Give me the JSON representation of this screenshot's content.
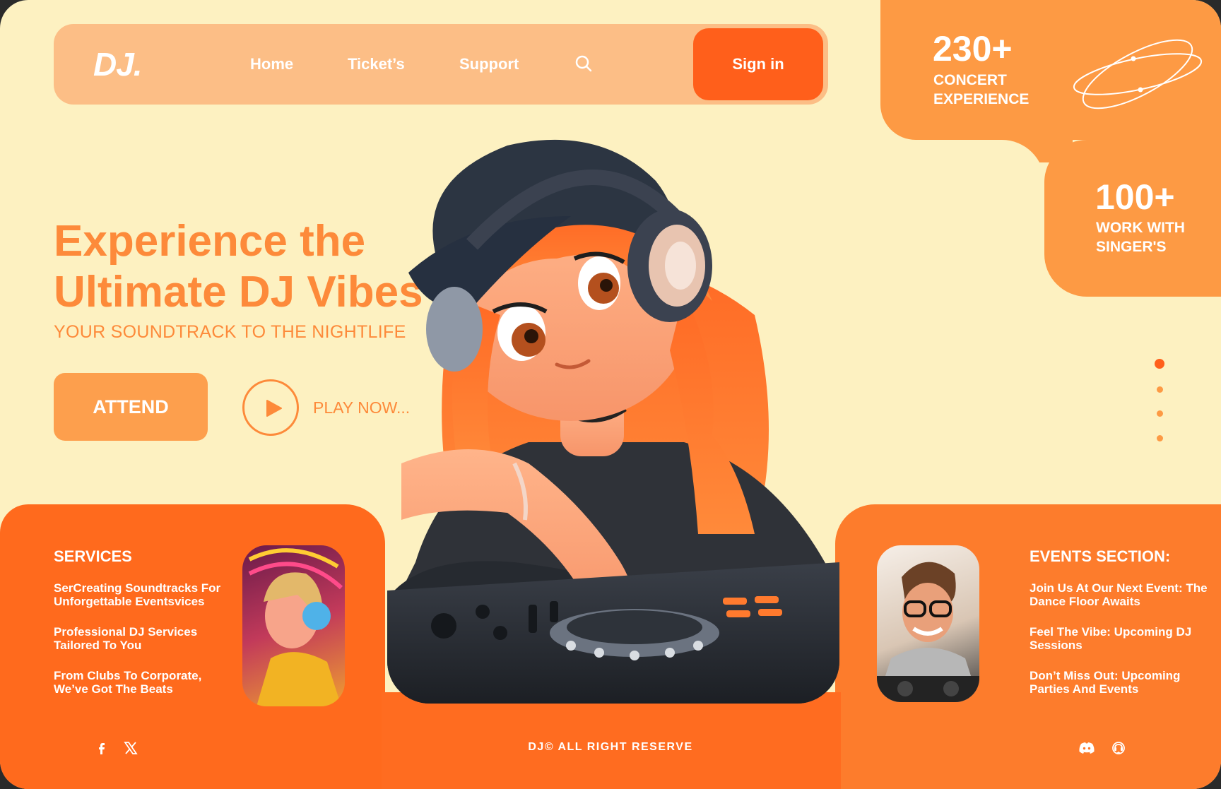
{
  "brand": {
    "logo": "DJ."
  },
  "nav": {
    "links": [
      "Home",
      "Ticket’s",
      "Support"
    ],
    "signin": "Sign in"
  },
  "stats": [
    {
      "value": "230+",
      "label_line1": "CONCERT",
      "label_line2": "EXPERIENCE"
    },
    {
      "value": "100+",
      "label_line1": "WORK WITH",
      "label_line2": "SINGER'S"
    }
  ],
  "hero": {
    "title_line1": "Experience the",
    "title_line2": "Ultimate DJ Vibes",
    "subtitle": "YOUR SOUNDTRACK TO THE NIGHTLIFE",
    "attend": "ATTEND",
    "play": "PLAY NOW..."
  },
  "slider": {
    "count": 4,
    "active_index": 0
  },
  "services": {
    "title": "SERVICES",
    "items": [
      {
        "l1": "SerCreating Soundtracks For",
        "l2": "Unforgettable Eventsvices"
      },
      {
        "l1": "Professional DJ Services",
        "l2": "Tailored To You"
      },
      {
        "l1": "From Clubs To Corporate,",
        "l2": "We’ve Got The Beats"
      }
    ]
  },
  "events": {
    "title": "EVENTS SECTION:",
    "items": [
      {
        "l1": "Join Us At Our Next Event: The",
        "l2": "Dance Floor Awaits"
      },
      {
        "l1": "Feel The Vibe: Upcoming DJ",
        "l2": "Sessions"
      },
      {
        "l1": "Don’t Miss Out: Upcoming",
        "l2": "Parties And Events"
      }
    ]
  },
  "footer": {
    "copyright": "DJ© ALL RIGHT RESERVE"
  },
  "icons": [
    "facebook-icon",
    "x-icon",
    "discord-icon",
    "support-chat-icon",
    "search-icon",
    "play-icon",
    "orbit-icon"
  ],
  "colors": {
    "accent": "#ff5f1b",
    "orange": "#fd9a44",
    "background": "#fdf1c1",
    "nav": "#fcbe86"
  }
}
